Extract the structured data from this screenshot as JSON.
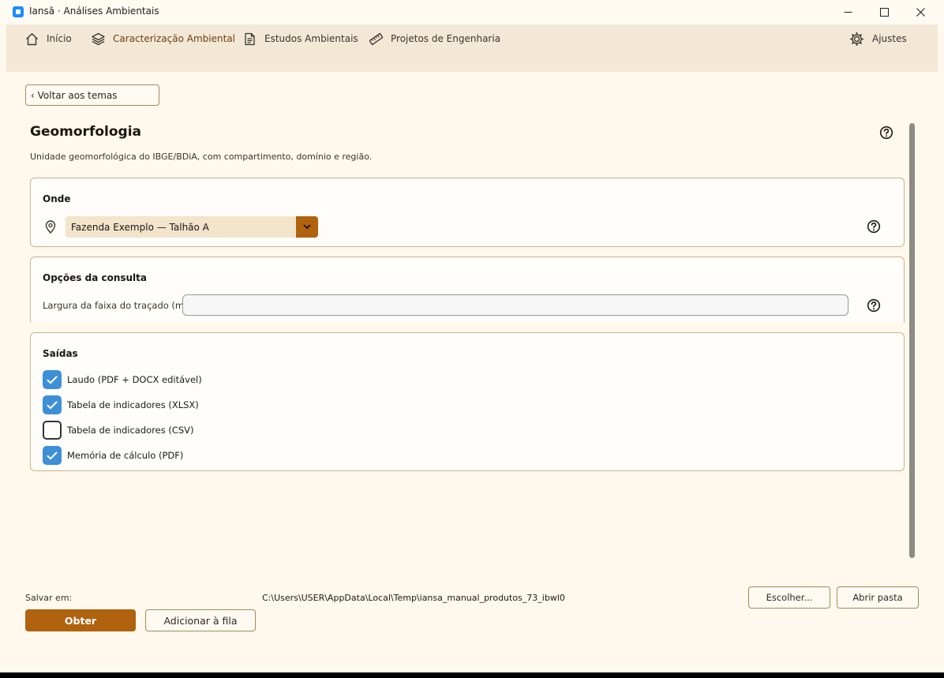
{
  "window": {
    "title": "Iansã · Análises Ambientais"
  },
  "nav": {
    "items": [
      {
        "label": "Início",
        "icon": "home-icon"
      },
      {
        "label": "Caracterização Ambiental",
        "icon": "layers-icon",
        "active": true
      },
      {
        "label": "Estudos Ambientais",
        "icon": "document-icon"
      },
      {
        "label": "Projetos de Engenharia",
        "icon": "ruler-icon"
      }
    ],
    "settings_label": "Ajustes"
  },
  "back_button": "‹ Voltar aos temas",
  "page": {
    "title": "Geomorfologia",
    "description": "Unidade geomorfológica do IBGE/BDiA, com compartimento, domínio e região."
  },
  "where": {
    "title": "Onde",
    "selected": "Fazenda Exemplo — Talhão A"
  },
  "options": {
    "title": "Opções da consulta",
    "width_label": "Largura da faixa do traçado (m)",
    "width_value": ""
  },
  "outputs": {
    "title": "Saídas",
    "items": [
      {
        "label": "Laudo (PDF + DOCX editável)",
        "checked": true
      },
      {
        "label": "Tabela de indicadores (XLSX)",
        "checked": true
      },
      {
        "label": "Tabela de indicadores (CSV)",
        "checked": false
      },
      {
        "label": "Memória de cálculo (PDF)",
        "checked": true
      }
    ]
  },
  "footer": {
    "save_label": "Salvar em:",
    "save_path": "C:\\Users\\USER\\AppData\\Local\\Temp\\iansa_manual_produtos_73_ibwl0",
    "choose_label": "Escolher...",
    "open_folder_label": "Abrir pasta",
    "obtain_label": "Obter",
    "queue_label": "Adicionar à fila"
  },
  "colors": {
    "accent": "#b0620f",
    "checkbox": "#3d8fd6",
    "background": "#fff8ec",
    "navbar": "#f3e8d6"
  }
}
